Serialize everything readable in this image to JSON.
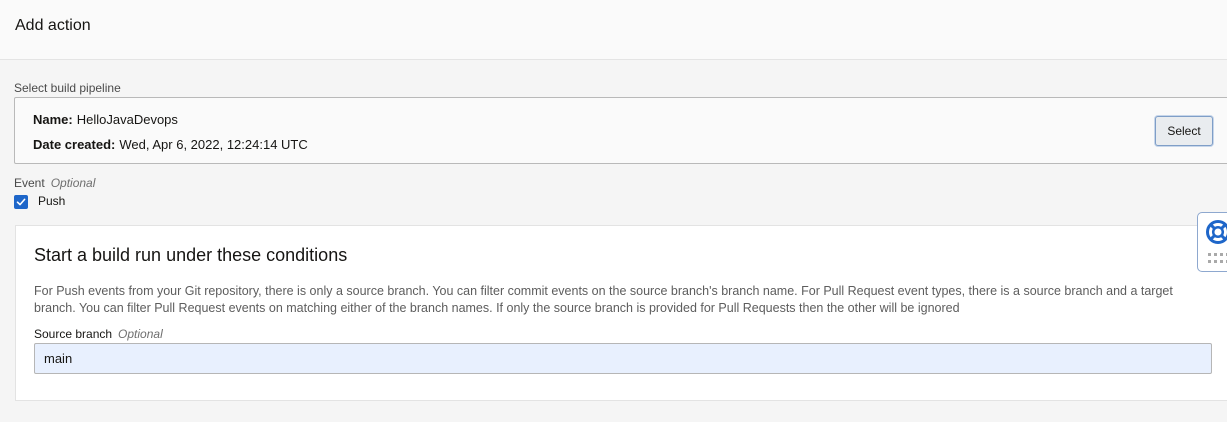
{
  "header": {
    "title": "Add action"
  },
  "pipeline": {
    "label": "Select build pipeline",
    "name_key": "Name:",
    "name_value": "HelloJavaDevops",
    "date_key": "Date created:",
    "date_value": "Wed, Apr 6, 2022, 12:24:14 UTC",
    "select_label": "Select"
  },
  "event": {
    "label": "Event",
    "optional": "Optional",
    "push_label": "Push",
    "push_checked": true
  },
  "conditions": {
    "title": "Start a build run under these conditions",
    "description": "For Push events from your Git repository, there is only a source branch. You can filter commit events on the source branch's branch name. For Pull Request event types, there is a source branch and a target branch. You can filter Pull Request events on matching either of the branch names. If only the source branch is provided for Pull Requests then the other will be ignored",
    "source_label": "Source branch",
    "source_optional": "Optional",
    "source_value": "main"
  },
  "help_widget": {
    "icon": "lifebuoy-icon",
    "handle_icon": "drag-dots-icon"
  },
  "colors": {
    "accent": "#1e66c9",
    "input_bg": "#e8f0fe"
  }
}
